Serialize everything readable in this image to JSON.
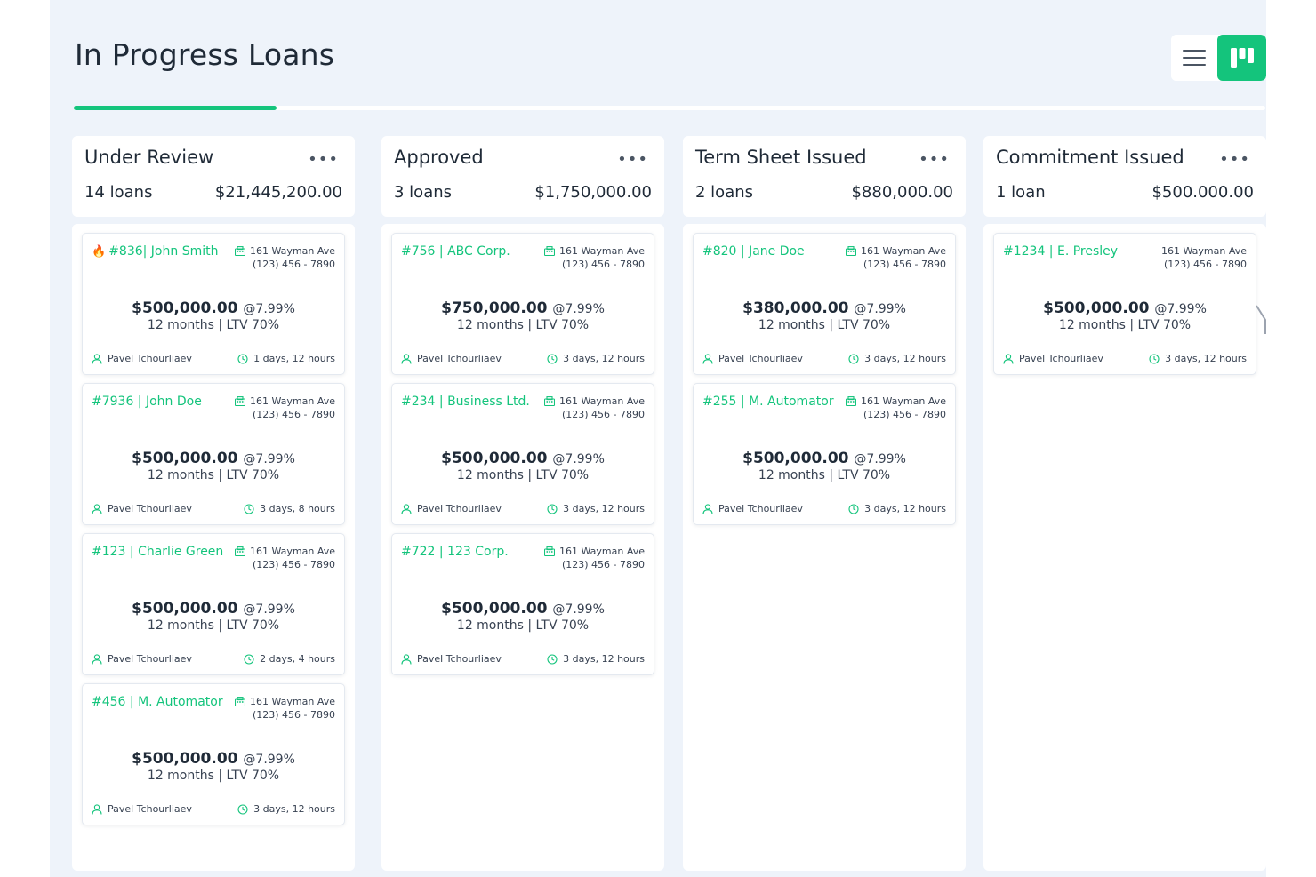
{
  "page": {
    "title": "In Progress Loans"
  },
  "colors": {
    "accent": "#14c47c",
    "hot": "#e5322d",
    "background": "#eef3fa"
  },
  "progress": {
    "fraction": 0.17
  },
  "view_toggle": {
    "active": "board",
    "icons": [
      "list-icon",
      "board-icon"
    ]
  },
  "columns": [
    {
      "title": "Under Review",
      "count": "14 loans",
      "total": "$21,445,200.00",
      "cards": [
        {
          "title": "#836| John Smith",
          "hot": true,
          "address": "161 Wayman Ave",
          "phone": "(123) 456 - 7890",
          "amount": "$500,000.00",
          "rate": "@7.99%",
          "terms": "12 months | LTV 70%",
          "agent": "Pavel Tchourliaev",
          "time": "1 days, 12 hours",
          "building_icon": true
        },
        {
          "title": "#7936 | John Doe",
          "hot": false,
          "address": "161 Wayman Ave",
          "phone": "(123) 456 - 7890",
          "amount": "$500,000.00",
          "rate": "@7.99%",
          "terms": "12 months | LTV 70%",
          "agent": "Pavel Tchourliaev",
          "time": "3 days, 8 hours",
          "building_icon": true
        },
        {
          "title": "#123 | Charlie Green",
          "hot": false,
          "address": "161 Wayman Ave",
          "phone": "(123) 456 - 7890",
          "amount": "$500,000.00",
          "rate": "@7.99%",
          "terms": "12 months | LTV 70%",
          "agent": "Pavel Tchourliaev",
          "time": "2 days, 4 hours",
          "building_icon": true
        },
        {
          "title": "#456 | M. Automator",
          "hot": false,
          "address": "161 Wayman Ave",
          "phone": "(123) 456 - 7890",
          "amount": "$500,000.00",
          "rate": "@7.99%",
          "terms": "12 months | LTV 70%",
          "agent": "Pavel Tchourliaev",
          "time": "3 days, 12 hours",
          "building_icon": true
        }
      ]
    },
    {
      "title": "Approved",
      "count": "3 loans",
      "total": "$1,750,000.00",
      "cards": [
        {
          "title": "#756 | ABC Corp.",
          "hot": false,
          "address": "161 Wayman Ave",
          "phone": "(123) 456 - 7890",
          "amount": "$750,000.00",
          "rate": "@7.99%",
          "terms": "12 months | LTV 70%",
          "agent": "Pavel Tchourliaev",
          "time": "3 days, 12 hours",
          "building_icon": true
        },
        {
          "title": "#234 | Business Ltd.",
          "hot": false,
          "address": "161 Wayman Ave",
          "phone": "(123) 456 - 7890",
          "amount": "$500,000.00",
          "rate": "@7.99%",
          "terms": "12 months | LTV 70%",
          "agent": "Pavel Tchourliaev",
          "time": "3 days, 12 hours",
          "building_icon": true
        },
        {
          "title": "#722 | 123 Corp.",
          "hot": false,
          "address": "161 Wayman Ave",
          "phone": "(123) 456 - 7890",
          "amount": "$500,000.00",
          "rate": "@7.99%",
          "terms": "12 months | LTV 70%",
          "agent": "Pavel Tchourliaev",
          "time": "3 days, 12 hours",
          "building_icon": true
        }
      ]
    },
    {
      "title": "Term Sheet Issued",
      "count": "2 loans",
      "total": "$880,000.00",
      "cards": [
        {
          "title": "#820 | Jane Doe",
          "hot": false,
          "address": "161 Wayman Ave",
          "phone": "(123) 456 - 7890",
          "amount": "$380,000.00",
          "rate": "@7.99%",
          "terms": "12 months | LTV 70%",
          "agent": "Pavel Tchourliaev",
          "time": "3 days, 12 hours",
          "building_icon": true
        },
        {
          "title": "#255 | M. Automator",
          "hot": false,
          "address": "161 Wayman Ave",
          "phone": "(123) 456 - 7890",
          "amount": "$500,000.00",
          "rate": "@7.99%",
          "terms": "12 months | LTV 70%",
          "agent": "Pavel Tchourliaev",
          "time": "3 days, 12 hours",
          "building_icon": true
        }
      ]
    },
    {
      "title": "Commitment Issued",
      "count": "1 loan",
      "total": "$500.000.00",
      "cards": [
        {
          "title": "#1234 | E. Presley",
          "hot": false,
          "address": "161 Wayman Ave",
          "phone": "(123) 456 - 7890",
          "amount": "$500,000.00",
          "rate": "@7.99%",
          "terms": "12 months | LTV 70%",
          "agent": "Pavel Tchourliaev",
          "time": "3 days, 12 hours",
          "building_icon": false
        }
      ]
    }
  ]
}
